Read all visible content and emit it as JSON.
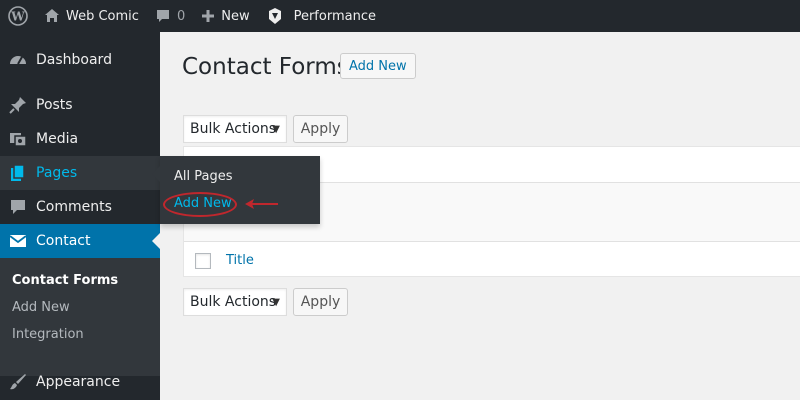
{
  "adminbar": {
    "site_name": "Web Comic",
    "comments_count": "0",
    "new_label": "New",
    "performance_label": "Performance"
  },
  "sidebar": {
    "items": [
      {
        "label": "Dashboard",
        "icon": "dashboard-icon"
      },
      {
        "label": "Posts",
        "icon": "pin-icon"
      },
      {
        "label": "Media",
        "icon": "media-icon"
      },
      {
        "label": "Pages",
        "icon": "pages-icon"
      },
      {
        "label": "Comments",
        "icon": "comment-icon"
      },
      {
        "label": "Contact",
        "icon": "mail-icon"
      },
      {
        "label": "Appearance",
        "icon": "brush-icon"
      }
    ],
    "submenu": [
      "Contact Forms",
      "Add New",
      "Integration"
    ]
  },
  "flyout": {
    "items": [
      "All Pages",
      "Add New"
    ]
  },
  "main": {
    "title": "Contact Forms",
    "add_new_label": "Add New",
    "bulk_actions_label": "Bulk Actions",
    "apply_label": "Apply",
    "table": {
      "column_title": "Title"
    }
  },
  "colors": {
    "adminbar_bg": "#23282d",
    "accent": "#0073aa",
    "highlight": "#00b9eb",
    "annotation": "#c0272d"
  }
}
